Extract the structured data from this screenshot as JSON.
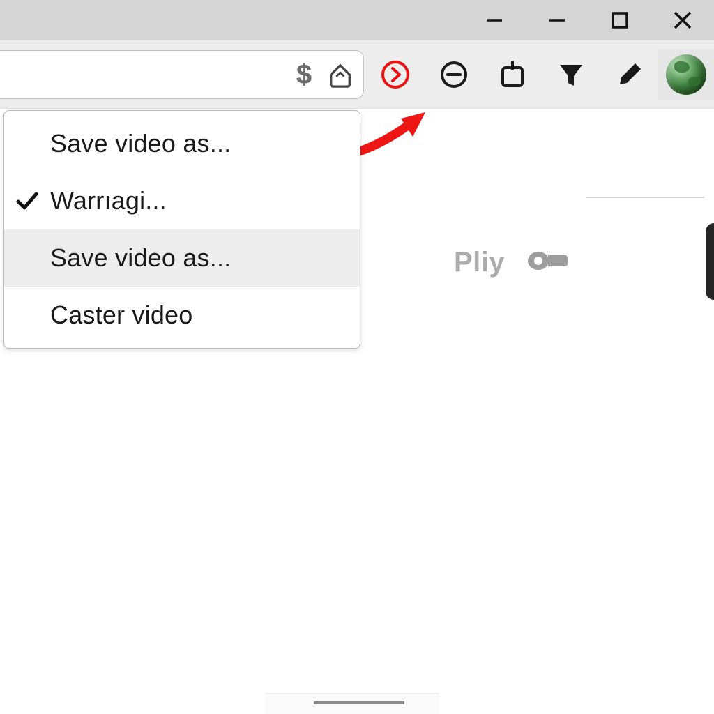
{
  "window_controls": {
    "minimize_title": "Minimize",
    "restore_title": "Restore",
    "maximize_title": "Maximize",
    "close_title": "Close"
  },
  "toolbar": {
    "dollar_title": "Price tracker",
    "home_title": "Home",
    "play_title": "Play",
    "timer_title": "Timer",
    "share_title": "Share",
    "filter_title": "Filter",
    "edit_title": "Edit",
    "profile_title": "Profile"
  },
  "menu": {
    "items": [
      {
        "label": "Save video as...",
        "checked": false,
        "hovered": false
      },
      {
        "label": "Warrıagi...",
        "checked": true,
        "hovered": false
      },
      {
        "label": "Save video as...",
        "checked": false,
        "hovered": true
      },
      {
        "label": "Caster video",
        "checked": false,
        "hovered": false
      }
    ]
  },
  "content": {
    "play_label": "Pliy"
  },
  "colors": {
    "accent_red": "#ee1111"
  }
}
